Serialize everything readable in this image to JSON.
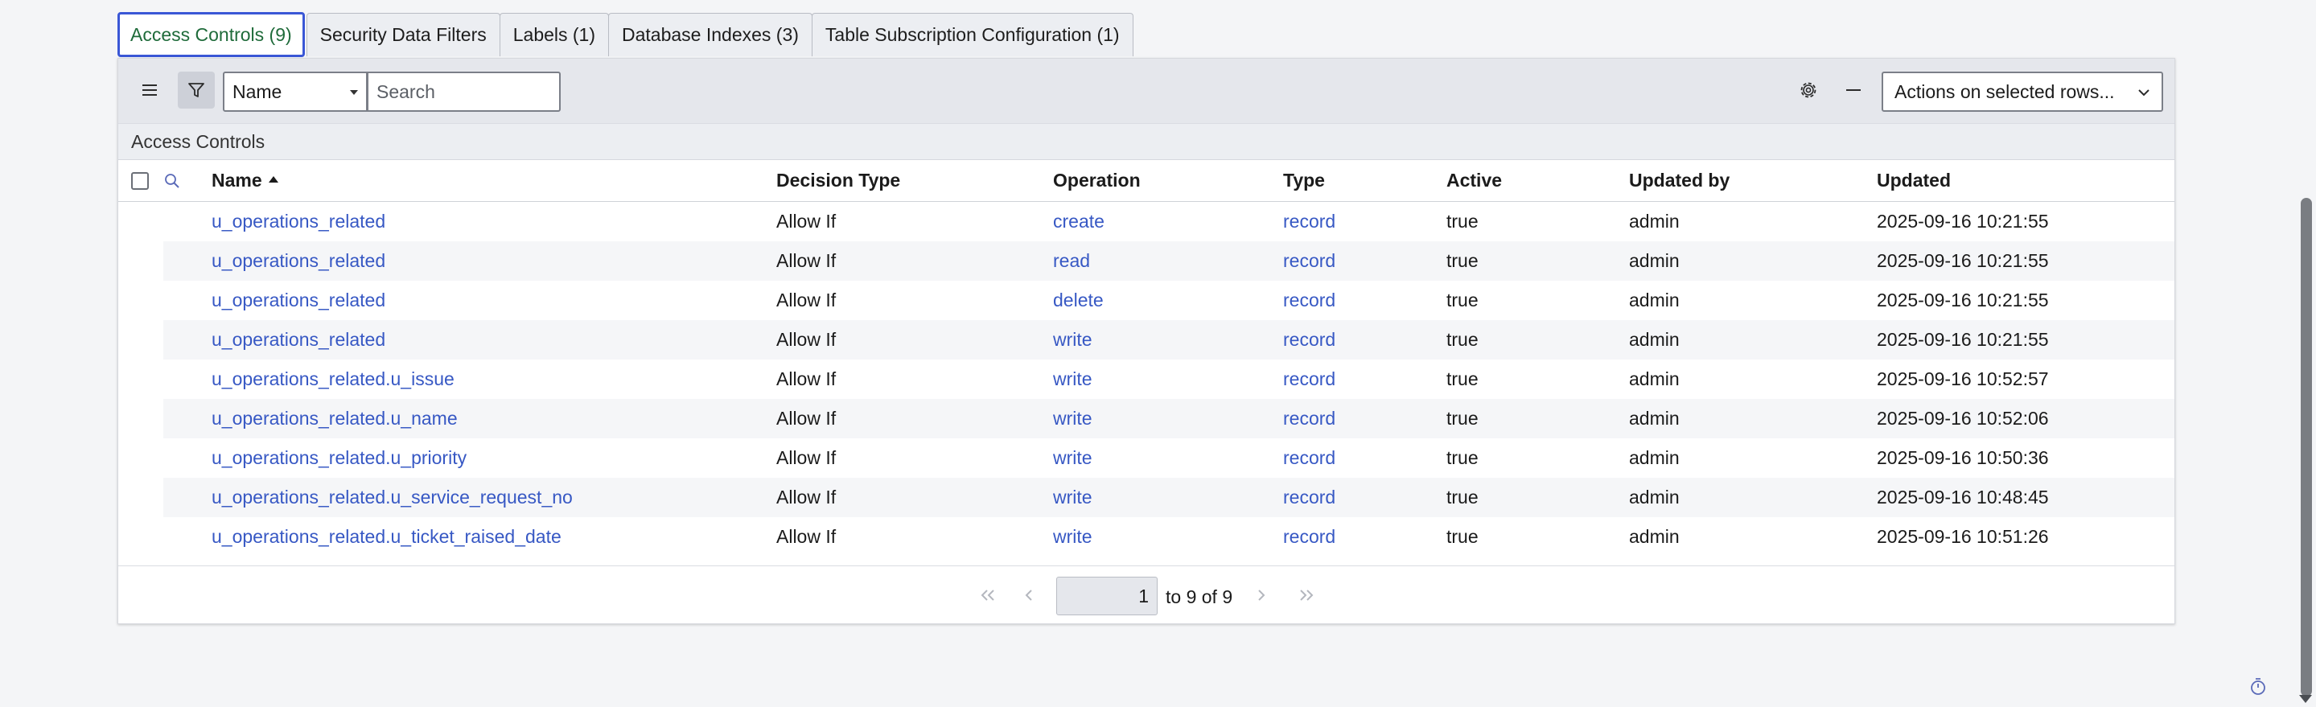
{
  "tabs": [
    {
      "label": "Access Controls (9)",
      "active": true
    },
    {
      "label": "Security Data Filters",
      "active": false
    },
    {
      "label": "Labels (1)",
      "active": false
    },
    {
      "label": "Database Indexes (3)",
      "active": false
    },
    {
      "label": "Table Subscription Configuration (1)",
      "active": false
    }
  ],
  "toolbar": {
    "field_select": "Name",
    "search_placeholder": "Search",
    "actions_select": "Actions on selected rows..."
  },
  "breadcrumb": "Access Controls",
  "table": {
    "columns": [
      "Name",
      "Decision Type",
      "Operation",
      "Type",
      "Active",
      "Updated by",
      "Updated"
    ],
    "sort_column": "Name",
    "rows": [
      {
        "name": "u_operations_related",
        "decision": "Allow If",
        "operation": "create",
        "type": "record",
        "active": "true",
        "updated_by": "admin",
        "updated": "2025-09-16 10:21:55"
      },
      {
        "name": "u_operations_related",
        "decision": "Allow If",
        "operation": "read",
        "type": "record",
        "active": "true",
        "updated_by": "admin",
        "updated": "2025-09-16 10:21:55"
      },
      {
        "name": "u_operations_related",
        "decision": "Allow If",
        "operation": "delete",
        "type": "record",
        "active": "true",
        "updated_by": "admin",
        "updated": "2025-09-16 10:21:55"
      },
      {
        "name": "u_operations_related",
        "decision": "Allow If",
        "operation": "write",
        "type": "record",
        "active": "true",
        "updated_by": "admin",
        "updated": "2025-09-16 10:21:55"
      },
      {
        "name": "u_operations_related.u_issue",
        "decision": "Allow If",
        "operation": "write",
        "type": "record",
        "active": "true",
        "updated_by": "admin",
        "updated": "2025-09-16 10:52:57"
      },
      {
        "name": "u_operations_related.u_name",
        "decision": "Allow If",
        "operation": "write",
        "type": "record",
        "active": "true",
        "updated_by": "admin",
        "updated": "2025-09-16 10:52:06"
      },
      {
        "name": "u_operations_related.u_priority",
        "decision": "Allow If",
        "operation": "write",
        "type": "record",
        "active": "true",
        "updated_by": "admin",
        "updated": "2025-09-16 10:50:36"
      },
      {
        "name": "u_operations_related.u_service_request_no",
        "decision": "Allow If",
        "operation": "write",
        "type": "record",
        "active": "true",
        "updated_by": "admin",
        "updated": "2025-09-16 10:48:45"
      },
      {
        "name": "u_operations_related.u_ticket_raised_date",
        "decision": "Allow If",
        "operation": "write",
        "type": "record",
        "active": "true",
        "updated_by": "admin",
        "updated": "2025-09-16 10:51:26"
      }
    ]
  },
  "pager": {
    "page_value": "1",
    "range_text": "to 9 of 9"
  },
  "colors": {
    "link": "#3758c4",
    "active_tab_text": "#1f6b3a",
    "active_tab_border": "#3a57d6"
  }
}
